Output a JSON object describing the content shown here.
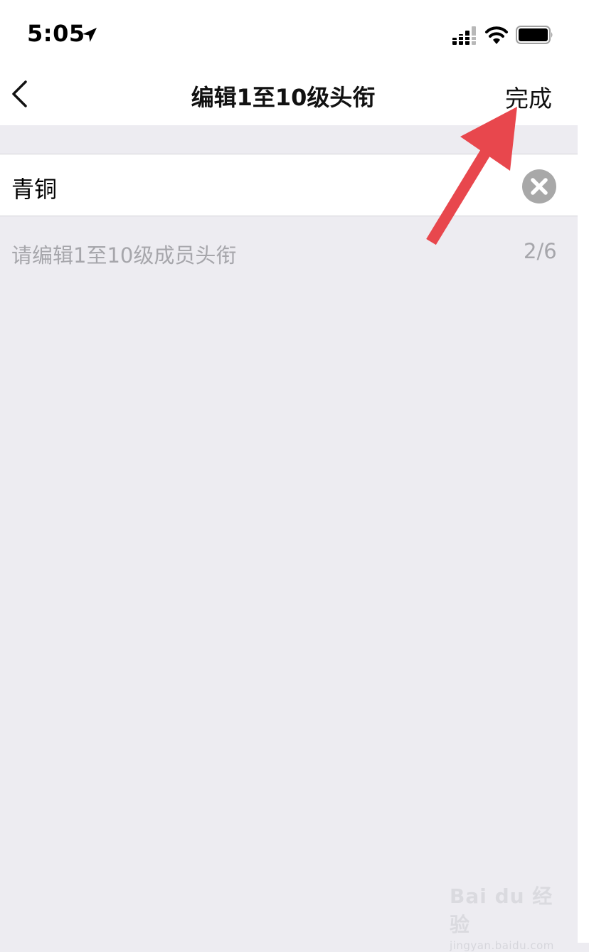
{
  "status_bar": {
    "time": "5:05"
  },
  "nav": {
    "title": "编辑1至10级头衔",
    "done_label": "完成"
  },
  "input": {
    "value": "青铜"
  },
  "hint": {
    "text": "请编辑1至10级成员头衔",
    "count": "2/6"
  },
  "annotation": {
    "arrow_color": "#e8474d"
  },
  "watermark": {
    "main": "Bai du 经验",
    "sub": "jingyan.baidu.com"
  }
}
